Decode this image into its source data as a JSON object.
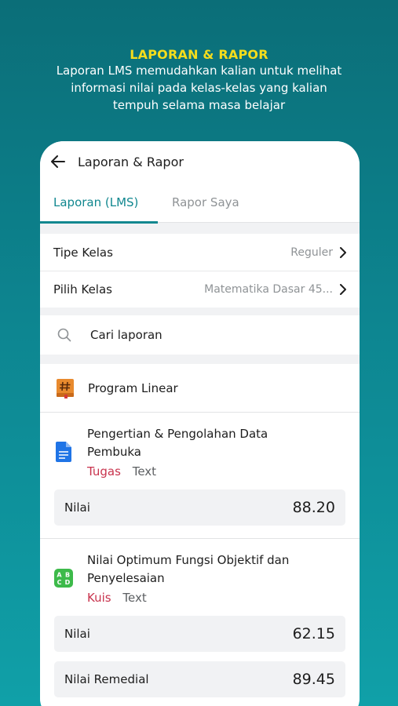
{
  "promo": {
    "title": "LAPORAN & RAPOR",
    "lines": [
      "Laporan LMS memudahkan kalian untuk melihat",
      "informasi nilai pada kelas-kelas yang kalian",
      "tempuh selama masa belajar"
    ]
  },
  "app": {
    "title": "Laporan & Rapor",
    "tabs": [
      {
        "label": "Laporan (LMS)",
        "active": true
      },
      {
        "label": "Rapor Saya",
        "active": false
      }
    ],
    "filters": [
      {
        "label": "Tipe Kelas",
        "value": "Reguler"
      },
      {
        "label": "Pilih Kelas",
        "value": "Matematika Dasar 45..."
      }
    ],
    "search": {
      "placeholder": "Cari laporan"
    },
    "course": {
      "title": "Program Linear",
      "icon": "hash-book-icon"
    },
    "items": [
      {
        "title_lines": [
          "Pengertian & Pengolahan Data",
          "Pembuka"
        ],
        "type": "Tugas",
        "format": "Text",
        "icon": "document-icon",
        "scores": [
          {
            "label": "Nilai",
            "value": "88.20"
          }
        ]
      },
      {
        "title_lines": [
          "Nilai Optimum Fungsi Objektif dan",
          "Penyelesaian"
        ],
        "type": "Kuis",
        "format": "Text",
        "icon": "abcd-quiz-icon",
        "scores": [
          {
            "label": "Nilai",
            "value": "62.15"
          },
          {
            "label": "Nilai Remedial",
            "value": "89.45"
          }
        ]
      }
    ]
  },
  "colors": {
    "accent": "#11878f",
    "highlight": "#f5dd1c",
    "type": "#c8334d"
  }
}
